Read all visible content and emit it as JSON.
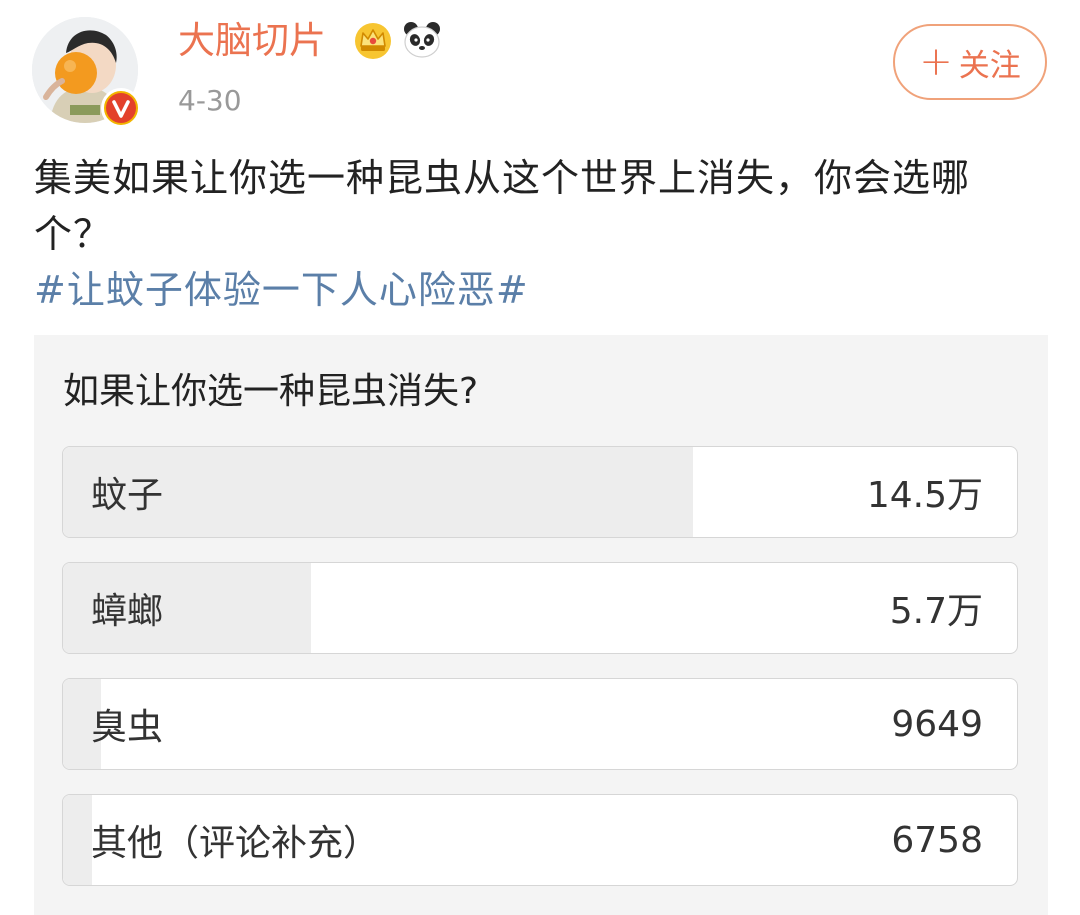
{
  "header": {
    "username": "大脑切片",
    "date": "4-30",
    "follow_label": "关注",
    "badge_icons": [
      "crown-icon",
      "panda-icon"
    ],
    "verified_icon": "verified-v-icon"
  },
  "post": {
    "text": "集美如果让你选一种昆虫从这个世界上消失，你会选哪个？",
    "hashtag": "#让蚊子体验一下人心险恶#"
  },
  "poll": {
    "question": "如果让你选一种昆虫消失?",
    "options": [
      {
        "label": "蚊子",
        "count": "14.5万",
        "share": 0.66
      },
      {
        "label": "蟑螂",
        "count": "5.7万",
        "share": 0.26
      },
      {
        "label": "臭虫",
        "count": "9649",
        "share": 0.04
      },
      {
        "label": "其他（评论补充）",
        "count": "6758",
        "share": 0.03
      }
    ]
  },
  "colors": {
    "accent": "#eb7350",
    "hashtag": "#5b7fa8",
    "poll_background": "#f4f4f4",
    "poll_fill": "#ededed",
    "verified": "#f2b400"
  }
}
